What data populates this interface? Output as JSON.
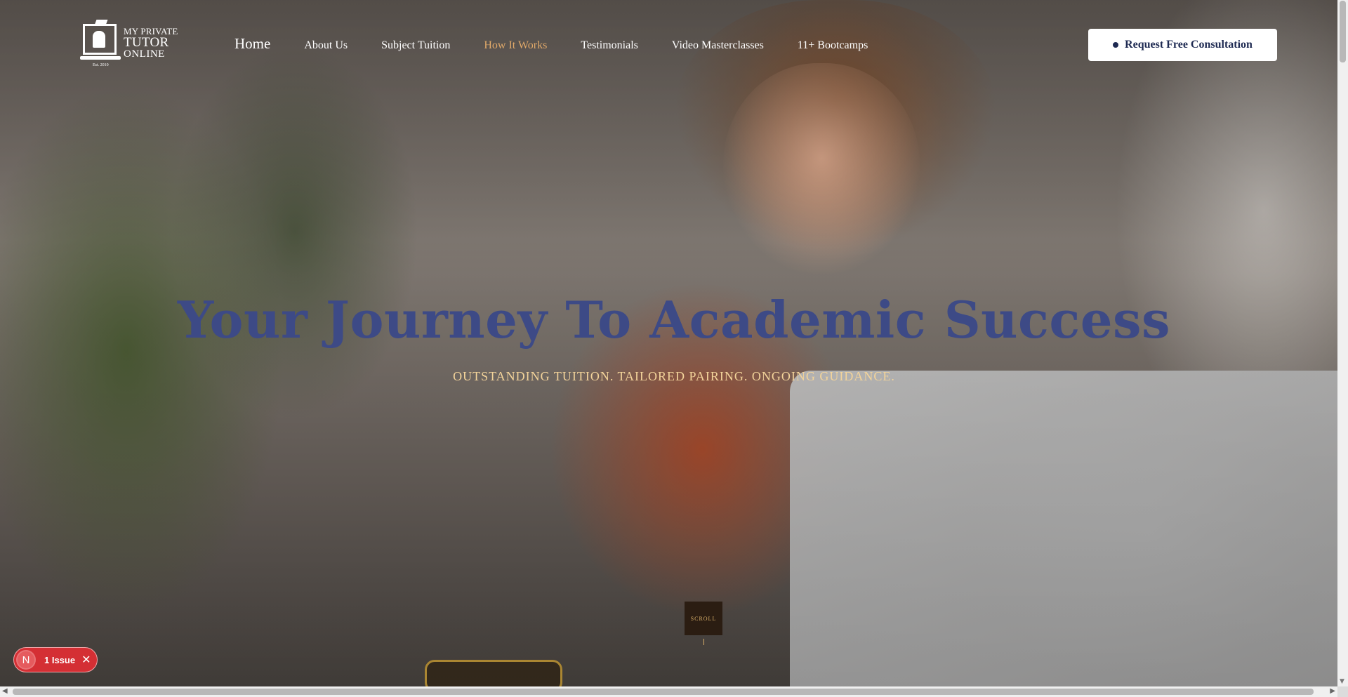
{
  "header": {
    "logo": {
      "line1": "MY PRIVATE",
      "line2": "TUTOR",
      "line3": "ONLINE",
      "est": "Est. 2010"
    },
    "nav": [
      {
        "label": "Home"
      },
      {
        "label": "About Us"
      },
      {
        "label": "Subject Tuition"
      },
      {
        "label": "How It Works"
      },
      {
        "label": "Testimonials"
      },
      {
        "label": "Video Masterclasses"
      },
      {
        "label": "11+ Bootcamps"
      }
    ],
    "cta_label": "Request Free Consultation"
  },
  "hero": {
    "title": "Your Journey To Academic Success",
    "subtitle": "OUTSTANDING TUITION. TAILORED PAIRING. ONGOING GUIDANCE.",
    "scroll_label": "SCROLL"
  },
  "issue_badge": {
    "avatar_letter": "N",
    "label": "1 Issue",
    "close": "✕"
  },
  "colors": {
    "title": "#3d4a86",
    "subtitle": "#f2d39a",
    "nav_active": "#e0a969",
    "cta_text": "#1e2a52",
    "issue_bg": "#d42f34"
  }
}
